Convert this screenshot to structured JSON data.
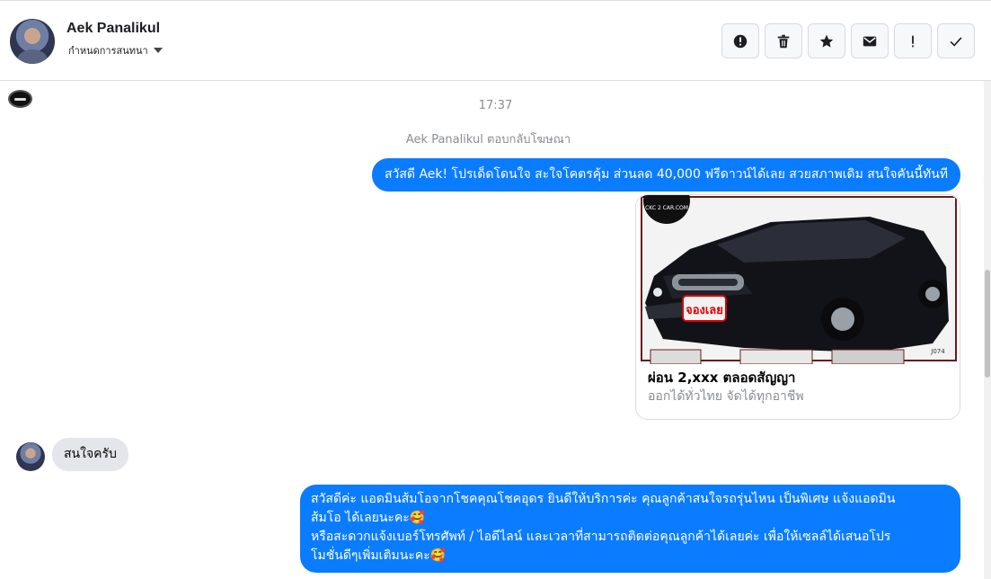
{
  "header": {
    "contact_name": "Aek Panalikul",
    "conversation_label": "กำหนดการสนทนา",
    "toolbar": [
      {
        "name": "report-button",
        "icon": "alert-circle-icon"
      },
      {
        "name": "delete-button",
        "icon": "trash-icon"
      },
      {
        "name": "star-button",
        "icon": "star-icon"
      },
      {
        "name": "mark-unread-button",
        "icon": "envelope-icon"
      },
      {
        "name": "spam-button",
        "icon": "exclamation-icon"
      },
      {
        "name": "mark-done-button",
        "icon": "check-icon"
      }
    ]
  },
  "chat": {
    "timestamp": "17:37",
    "system_message": "Aek Panalikul ตอบกลับโฆษณา",
    "messages": [
      {
        "direction": "out",
        "text": "สวัสดี Aek! โปรเด็ดโดนใจ สะใจโคตรคุ้ม ส่วนลด 40,000 ฟรีดาวน์ได้เลย สวยสภาพเดิม สนใจคันนี้ทันที"
      },
      {
        "direction": "in",
        "text": "สนใจครับ"
      }
    ],
    "ad_card": {
      "title": "ผ่อน 2,xxx ตลอดสัญญา",
      "subtitle": "ออกได้ทั่วไทย จัดได้ทุกอาชีพ",
      "badge_text": "จองเลย",
      "logo_text": "CKC 2 CAR.COM",
      "watermark": "J074"
    },
    "long_reply_lines": [
      "สวัสดีค่ะ แอดมินส้มโอจากโชคคุณโชคอุดร ยินดีให้บริการค่ะ   คุณลูกค้าสนใจรถรุ่นไหน เป็นพิเศษ แจ้งแอดมิน",
      "ส้มโอ ได้เลยนะคะ🥰",
      "หรือสะดวกแจ้งเบอร์โทรศัพท์ / ไอดีไลน์ และเวลาที่สามารถติดต่อคุณลูกค้าได้เลยค่ะ เพื่อให้เซลล์ได้เสนอโปร",
      "โมชั่นดีๆเพิ่มเติมนะคะ🥰"
    ]
  },
  "colors": {
    "outgoing_bubble": "#0a7cff",
    "incoming_bubble": "#e4e6eb",
    "muted_text": "#8a8d91"
  }
}
